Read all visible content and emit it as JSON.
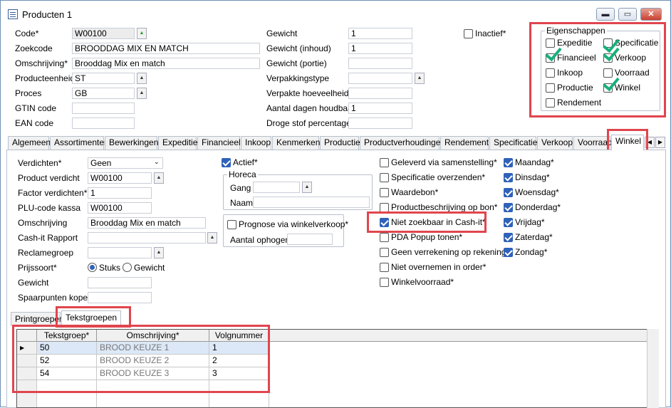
{
  "window": {
    "title": "Producten 1",
    "minimize": "▬",
    "maximize": "▭",
    "close": "✕"
  },
  "top": {
    "code": {
      "label": "Code*",
      "value": "W00100"
    },
    "zoekcode": {
      "label": "Zoekcode",
      "value": "BROODDAG MIX EN MATCH"
    },
    "omschrijving": {
      "label": "Omschrijving*",
      "value": "Brooddag Mix en match"
    },
    "producteenheid": {
      "label": "Producteenheid",
      "value": "ST"
    },
    "proces": {
      "label": "Proces",
      "value": "GB"
    },
    "gtin": {
      "label": "GTIN code",
      "value": ""
    },
    "ean": {
      "label": "EAN code",
      "value": ""
    },
    "gewicht": {
      "label": "Gewicht",
      "value": "1"
    },
    "gewicht_inhoud": {
      "label": "Gewicht (inhoud)",
      "value": "1"
    },
    "gewicht_portie": {
      "label": "Gewicht (portie)",
      "value": ""
    },
    "verpakkingstype": {
      "label": "Verpakkingstype",
      "value": ""
    },
    "verpakte_hoeveelheid": {
      "label": "Verpakte hoeveelheid",
      "value": ""
    },
    "houdbaar": {
      "label": "Aantal dagen houdbaar",
      "value": "1"
    },
    "droge_stof": {
      "label": "Droge stof percentage",
      "value": ""
    },
    "inactief": {
      "label": "Inactief*",
      "checked": false
    }
  },
  "eigenschappen": {
    "title": "Eigenschappen",
    "items": [
      {
        "label": "Expeditie",
        "checked": false
      },
      {
        "label": "Specificatie",
        "checked": true
      },
      {
        "label": "Financieel",
        "checked": true
      },
      {
        "label": "Verkoop",
        "checked": true
      },
      {
        "label": "Inkoop",
        "checked": false
      },
      {
        "label": "Voorraad",
        "checked": false
      },
      {
        "label": "Productie",
        "checked": false
      },
      {
        "label": "Winkel",
        "checked": true
      },
      {
        "label": "Rendement",
        "checked": false
      }
    ]
  },
  "tabs": [
    "Algemeen",
    "Assortimenten",
    "Bewerkingen",
    "Expeditie",
    "Financieel",
    "Inkoop",
    "Kenmerken",
    "Productie",
    "Productverhoudingen",
    "Rendement",
    "Specificatie",
    "Verkoop",
    "Voorraad",
    "Winkel"
  ],
  "winkel": {
    "verdichten": {
      "label": "Verdichten*",
      "value": "Geen"
    },
    "product_verdicht": {
      "label": "Product verdicht",
      "value": "W00100"
    },
    "factor_verdichten": {
      "label": "Factor verdichten*",
      "value": "1"
    },
    "plu": {
      "label": "PLU-code kassa",
      "value": "W00100"
    },
    "omschrijving": {
      "label": "Omschrijving",
      "value": "Brooddag Mix en match"
    },
    "cashit_rapport": {
      "label": "Cash-it Rapport",
      "value": ""
    },
    "reclamegroep": {
      "label": "Reclamegroep",
      "value": ""
    },
    "prijssoort": {
      "label": "Prijssoort*",
      "opt1": "Stuks",
      "opt2": "Gewicht"
    },
    "gewicht": {
      "label": "Gewicht",
      "value": ""
    },
    "spaarpunten": {
      "label": "Spaarpunten kopen",
      "value": ""
    },
    "actief": {
      "label": "Actief*",
      "checked": true
    },
    "horeca": {
      "title": "Horeca",
      "gang": "Gang",
      "naam": "Naam"
    },
    "prognose": {
      "label": "Prognose via winkelverkoop*",
      "aantal": "Aantal ophogen"
    },
    "options": [
      {
        "label": "Geleverd via samenstelling*",
        "checked": false
      },
      {
        "label": "Specificatie overzenden*",
        "checked": false
      },
      {
        "label": "Waardebon*",
        "checked": false
      },
      {
        "label": "Productbeschrijving op bon*",
        "checked": false
      },
      {
        "label": "Niet zoekbaar in Cash-it*",
        "checked": true
      },
      {
        "label": "PDA Popup tonen*",
        "checked": false
      },
      {
        "label": "Geen verrekening op rekening*",
        "checked": false
      },
      {
        "label": "Niet overnemen in order*",
        "checked": false
      },
      {
        "label": "Winkelvoorraad*",
        "checked": false
      }
    ],
    "days": [
      {
        "label": "Maandag*",
        "checked": true
      },
      {
        "label": "Dinsdag*",
        "checked": true
      },
      {
        "label": "Woensdag*",
        "checked": true
      },
      {
        "label": "Donderdag*",
        "checked": true
      },
      {
        "label": "Vrijdag*",
        "checked": true
      },
      {
        "label": "Zaterdag*",
        "checked": true
      },
      {
        "label": "Zondag*",
        "checked": true
      }
    ]
  },
  "subtabs": [
    "Printgroepen",
    "Tekstgroepen"
  ],
  "table": {
    "headers": [
      "Tekstgroep*",
      "Omschrijving*",
      "Volgnummer"
    ],
    "rows": [
      [
        "50",
        "BROOD KEUZE 1",
        "1"
      ],
      [
        "52",
        "BROOD KEUZE 2",
        "2"
      ],
      [
        "54",
        "BROOD KEUZE 3",
        "3"
      ]
    ]
  },
  "colors": {
    "highlight": "#e0454e",
    "check": "#2f62b9",
    "tick": "#17b07a"
  }
}
